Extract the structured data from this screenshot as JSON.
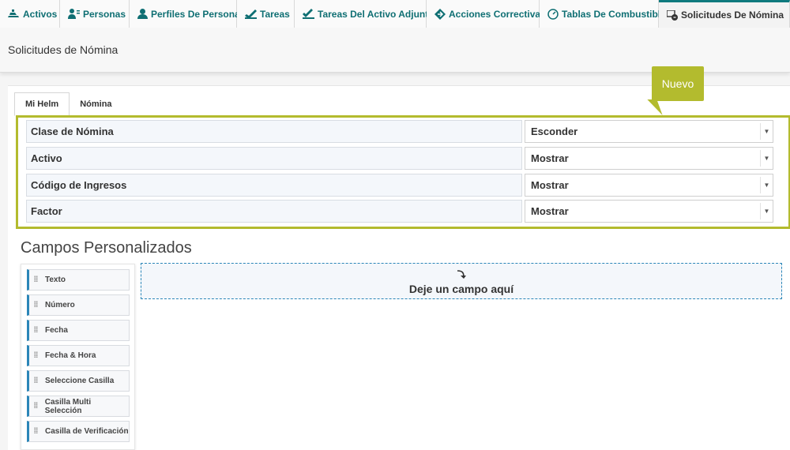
{
  "top_tabs": [
    {
      "label": "Activos",
      "icon": "asset-icon"
    },
    {
      "label": "Personas",
      "icon": "people-icon"
    },
    {
      "label": "Perfiles De Persona",
      "icon": "person-profile-icon"
    },
    {
      "label": "Tareas",
      "icon": "task-icon"
    },
    {
      "label": "Tareas Del Activo Adjunto",
      "icon": "task-attached-icon"
    },
    {
      "label": "Acciones Correctivas",
      "icon": "corrective-action-icon"
    },
    {
      "label": "Tablas De Combustible",
      "icon": "fuel-gauge-icon"
    },
    {
      "label": "Solicitudes De Nómina",
      "icon": "payroll-request-icon",
      "active": true
    }
  ],
  "page": {
    "title": "Solicitudes de Nómina"
  },
  "sub_tabs": [
    {
      "label": "Mi Helm",
      "active": true
    },
    {
      "label": "Nómina"
    }
  ],
  "fields": [
    {
      "label": "Clase de Nómina",
      "value": "Esconder"
    },
    {
      "label": "Activo",
      "value": "Mostrar"
    },
    {
      "label": "Código de Ingresos",
      "value": "Mostrar"
    },
    {
      "label": "Factor",
      "value": "Mostrar"
    }
  ],
  "callout": {
    "text": "Nuevo"
  },
  "custom": {
    "title": "Campos Personalizados",
    "palette": [
      {
        "label": "Texto"
      },
      {
        "label": "Número"
      },
      {
        "label": "Fecha"
      },
      {
        "label": "Fecha & Hora"
      },
      {
        "label": "Seleccione Casilla"
      },
      {
        "label": "Casilla Multi Selección"
      },
      {
        "label": "Casilla de Verificación"
      }
    ],
    "dropzone_text": "Deje un campo aquí"
  },
  "colors": {
    "accent": "#0f7a7e",
    "highlight": "#b3bb2e",
    "drag": "#2b86b8"
  }
}
